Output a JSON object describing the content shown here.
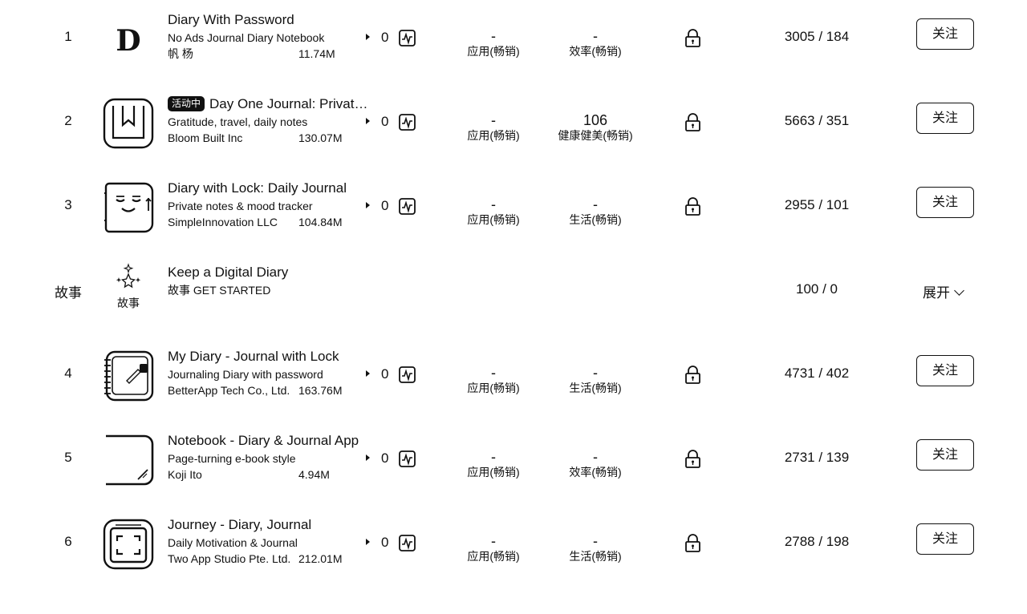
{
  "rows": [
    {
      "type": "app",
      "rank": "1",
      "icon": "d-letter-icon",
      "title": "Diary With Password",
      "badge": "",
      "subtitle": "No Ads Journal Diary Notebook",
      "developer": "帆 杨",
      "size": "11.74M",
      "signal_count": "0",
      "rank1_value": "-",
      "rank1_label": "应用(畅销)",
      "rank2_value": "-",
      "rank2_label": "效率(畅销)",
      "score": "3005 / 184",
      "action": "关注"
    },
    {
      "type": "app",
      "rank": "2",
      "icon": "day-one-bookmark-icon",
      "title": "Day One Journal: Private Diary",
      "badge": "活动中",
      "subtitle": "Gratitude, travel, daily notes",
      "developer": "Bloom Built Inc",
      "size": "130.07M",
      "signal_count": "0",
      "rank1_value": "-",
      "rank1_label": "应用(畅销)",
      "rank2_value": "106",
      "rank2_label": "健康健美(畅销)",
      "score": "5663 / 351",
      "action": "关注"
    },
    {
      "type": "app",
      "rank": "3",
      "icon": "smiling-notebook-icon",
      "title": "Diary with Lock: Daily Journal",
      "badge": "",
      "subtitle": "Private notes & mood tracker",
      "developer": "SimpleInnovation LLC",
      "size": "104.84M",
      "signal_count": "0",
      "rank1_value": "-",
      "rank1_label": "应用(畅销)",
      "rank2_value": "-",
      "rank2_label": "生活(畅销)",
      "score": "2955 / 101",
      "action": "关注"
    },
    {
      "type": "story",
      "rank": "故事",
      "icon": "story-sparkle-icon",
      "icon_label": "故事",
      "title": "Keep a Digital Diary",
      "subtitle": "故事 GET STARTED",
      "score": "100 / 0",
      "action": "展开"
    },
    {
      "type": "app",
      "rank": "4",
      "icon": "spiral-diary-icon",
      "title": "My Diary - Journal with Lock",
      "badge": "",
      "subtitle": "Journaling Diary with password",
      "developer": "BetterApp Tech Co., Ltd.",
      "size": "163.76M",
      "signal_count": "0",
      "rank1_value": "-",
      "rank1_label": "应用(畅销)",
      "rank2_value": "-",
      "rank2_label": "生活(畅销)",
      "score": "4731 / 402",
      "action": "关注"
    },
    {
      "type": "app",
      "rank": "5",
      "icon": "page-curl-notebook-icon",
      "title": "Notebook - Diary & Journal App",
      "badge": "",
      "subtitle": "Page-turning e-book style",
      "developer": "Koji Ito",
      "size": "4.94M",
      "signal_count": "0",
      "rank1_value": "-",
      "rank1_label": "应用(畅销)",
      "rank2_value": "-",
      "rank2_label": "效率(畅销)",
      "score": "2731 / 139",
      "action": "关注"
    },
    {
      "type": "app",
      "rank": "6",
      "icon": "journey-frame-icon",
      "title": "Journey - Diary, Journal",
      "badge": "",
      "subtitle": "Daily Motivation & Journal",
      "developer": "Two App Studio Pte. Ltd.",
      "size": "212.01M",
      "signal_count": "0",
      "rank1_value": "-",
      "rank1_label": "应用(畅销)",
      "rank2_value": "-",
      "rank2_label": "生活(畅销)",
      "score": "2788 / 198",
      "action": "关注"
    }
  ]
}
